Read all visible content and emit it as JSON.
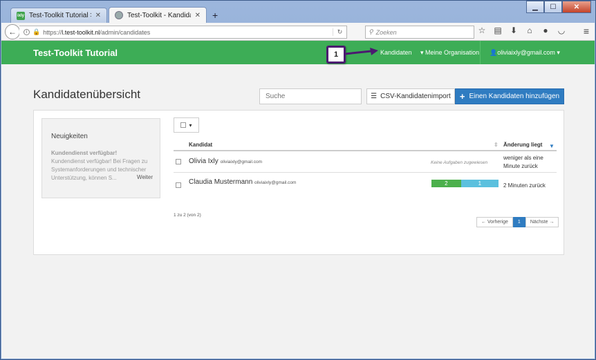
{
  "browser": {
    "tabs": [
      {
        "title": "Test-Toolkit Tutorial > Ixly",
        "favicon_text": "ixly"
      },
      {
        "title": "Test-Toolkit - Kandidatenü..."
      }
    ],
    "url_prefix": "https://",
    "url_domain": "l.test-toolkit.nl",
    "url_path": "/admin/candidates",
    "search_placeholder": "Zoeken"
  },
  "header": {
    "brand": "Test-Toolkit Tutorial",
    "nav_candidates": "Kandidaten",
    "nav_org": "Meine Organisation",
    "nav_user": "oliviaixly@gmail.com"
  },
  "annotation": {
    "number": "1"
  },
  "main": {
    "title": "Kandidatenübersicht",
    "search_placeholder": "Suche",
    "csv_button": "CSV-Kandidatenimport",
    "add_button": "Einen Kandidaten hinzufügen"
  },
  "news": {
    "title": "Neuigkeiten",
    "headline": "Kundendienst verfügbar!",
    "body": "Kundendienst verfügbar! Bei Fragen zu Systemanforderungen und technischer Unterstützung, können S...",
    "more": "Weiter"
  },
  "table": {
    "col_candidate": "Kandidat",
    "col_changed": "Änderung liegt",
    "rows": [
      {
        "name": "Olivia Ixly",
        "email": "oliviaixly@gmail.com",
        "tasks": "Keine Aufgaben zugewiesen",
        "changed": "weniger als eine Minute zurück"
      },
      {
        "name": "Claudia Mustermann",
        "email": "oliviaixly@gmail.com",
        "progress_done": "2",
        "progress_open": "1",
        "progress_done_value": 2,
        "progress_open_value": 1,
        "changed": "2 Minuten zurück"
      }
    ],
    "count": "1 zu 2 (von 2)"
  },
  "pager": {
    "prev": "← Vorherige",
    "current": "1",
    "next": "Nächste →"
  },
  "colors": {
    "header": "#3dad56",
    "primary": "#2f7cc1",
    "annotation": "#4b1970"
  }
}
